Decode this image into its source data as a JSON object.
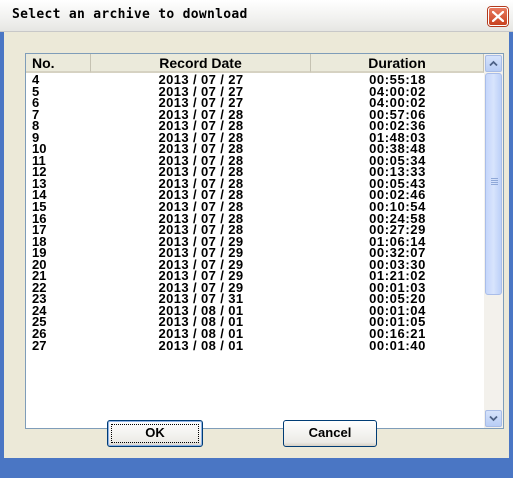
{
  "window": {
    "title": "Select an archive to download",
    "close_icon": "close-icon"
  },
  "table": {
    "columns": [
      "No.",
      "Record Date",
      "Duration"
    ],
    "rows": [
      {
        "no": "4",
        "date": "2013 / 07 / 27",
        "duration": "00:55:18"
      },
      {
        "no": "5",
        "date": "2013 / 07 / 27",
        "duration": "04:00:02"
      },
      {
        "no": "6",
        "date": "2013 / 07 / 27",
        "duration": "04:00:02"
      },
      {
        "no": "7",
        "date": "2013 / 07 / 28",
        "duration": "00:57:06"
      },
      {
        "no": "8",
        "date": "2013 / 07 / 28",
        "duration": "00:02:36"
      },
      {
        "no": "9",
        "date": "2013 / 07 / 28",
        "duration": "01:48:03"
      },
      {
        "no": "10",
        "date": "2013 / 07 / 28",
        "duration": "00:38:48"
      },
      {
        "no": "11",
        "date": "2013 / 07 / 28",
        "duration": "00:05:34"
      },
      {
        "no": "12",
        "date": "2013 / 07 / 28",
        "duration": "00:13:33"
      },
      {
        "no": "13",
        "date": "2013 / 07 / 28",
        "duration": "00:05:43"
      },
      {
        "no": "14",
        "date": "2013 / 07 / 28",
        "duration": "00:02:46"
      },
      {
        "no": "15",
        "date": "2013 / 07 / 28",
        "duration": "00:10:54"
      },
      {
        "no": "16",
        "date": "2013 / 07 / 28",
        "duration": "00:24:58"
      },
      {
        "no": "17",
        "date": "2013 / 07 / 28",
        "duration": "00:27:29"
      },
      {
        "no": "18",
        "date": "2013 / 07 / 29",
        "duration": "01:06:14"
      },
      {
        "no": "19",
        "date": "2013 / 07 / 29",
        "duration": "00:32:07"
      },
      {
        "no": "20",
        "date": "2013 / 07 / 29",
        "duration": "00:03:30"
      },
      {
        "no": "21",
        "date": "2013 / 07 / 29",
        "duration": "01:21:02"
      },
      {
        "no": "22",
        "date": "2013 / 07 / 29",
        "duration": "00:01:03"
      },
      {
        "no": "23",
        "date": "2013 / 07 / 31",
        "duration": "00:05:20"
      },
      {
        "no": "24",
        "date": "2013 / 08 / 01",
        "duration": "00:01:04"
      },
      {
        "no": "25",
        "date": "2013 / 08 / 01",
        "duration": "00:01:05"
      },
      {
        "no": "26",
        "date": "2013 / 08 / 01",
        "duration": "00:16:21"
      },
      {
        "no": "27",
        "date": "2013 / 08 / 01",
        "duration": "00:01:40"
      }
    ]
  },
  "buttons": {
    "ok_label": "OK",
    "cancel_label": "Cancel"
  },
  "colors": {
    "window_frame": "#4a76c4",
    "dialog_face": "#ece9d8",
    "close_button": "#c8411f",
    "scrollbar_thumb": "#c5d6fb"
  }
}
